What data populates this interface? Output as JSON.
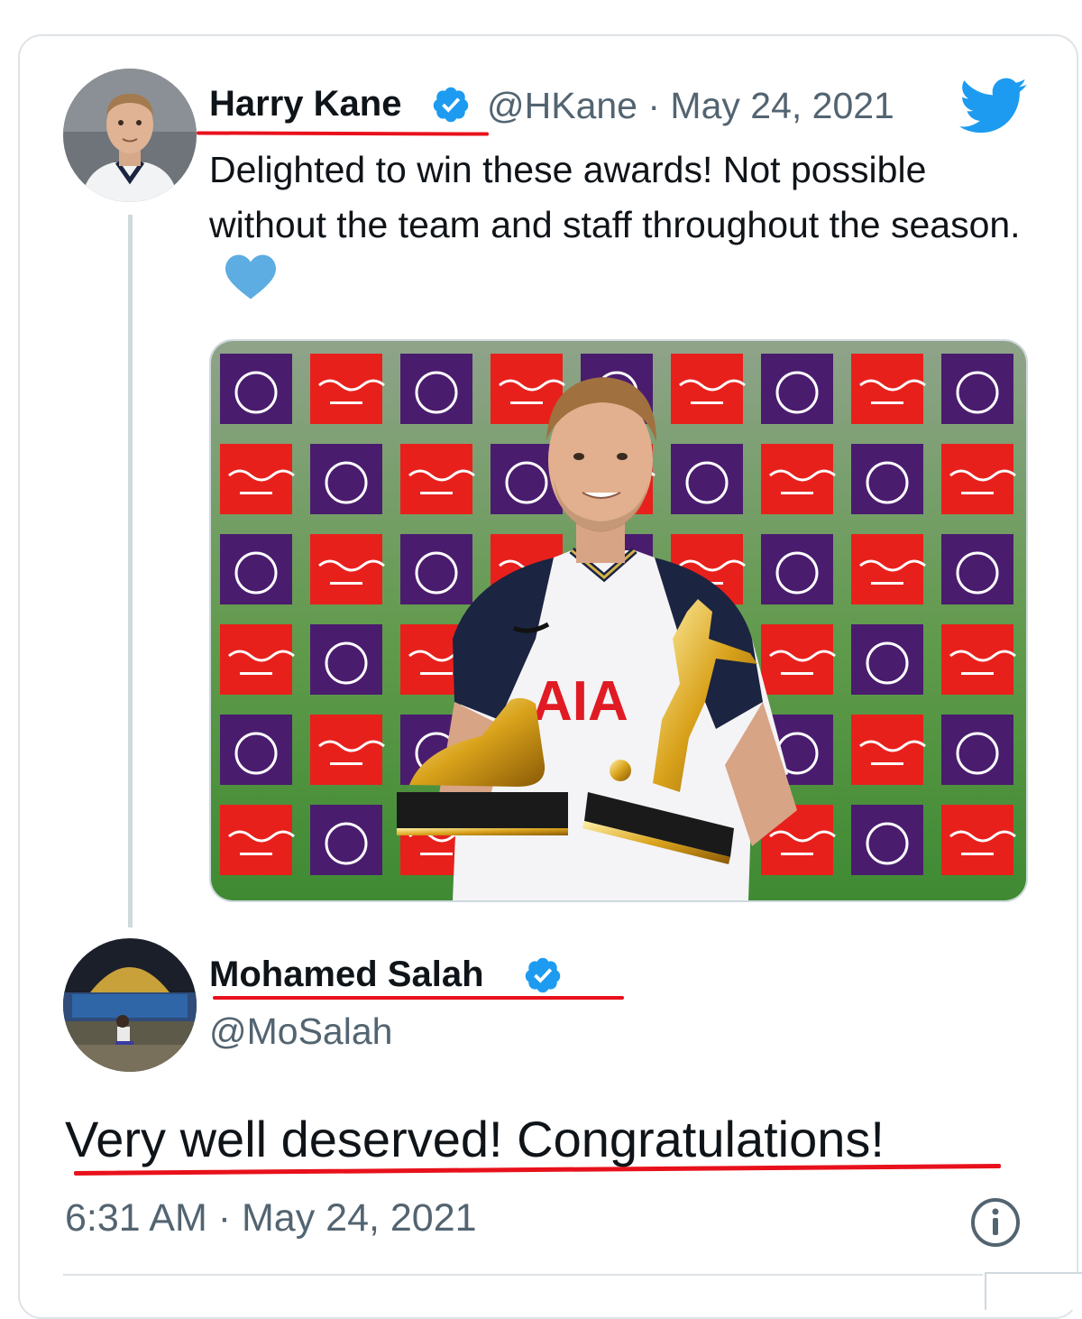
{
  "tweet": {
    "author_name": "Harry Kane",
    "handle_date": "@HKane · May 24, 2021",
    "text": "Delighted to win these awards! Not possible without the team and staff throughout the season.",
    "image_alt": "Harry Kane holding Golden Boot and Playmaker trophies",
    "icons": [
      "verified-badge-icon",
      "twitter-bird-icon",
      "blue-heart-icon"
    ]
  },
  "reply": {
    "author_name": "Mohamed Salah",
    "handle": "@MoSalah",
    "text": "Very well deserved! Congratulations!",
    "timestamp": "6:31 AM · May 24, 2021",
    "icons": [
      "verified-badge-icon",
      "info-icon"
    ]
  },
  "colors": {
    "twitter_blue": "#1d9bf0",
    "annotation_red": "#e8111b",
    "secondary_text": "#536471",
    "pl_purple": "#4a1c6e",
    "coke_red": "#e8201c"
  }
}
